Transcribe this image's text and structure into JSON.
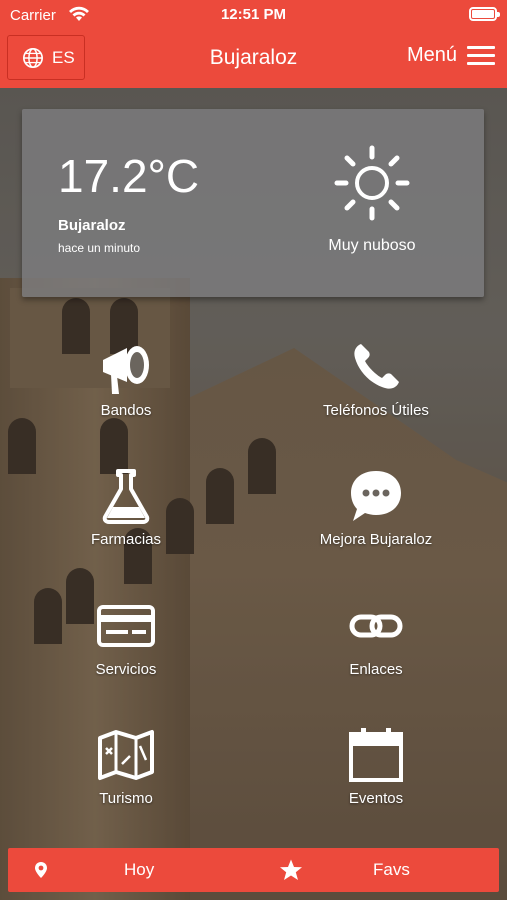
{
  "status_bar": {
    "carrier": "Carrier",
    "time": "12:51 PM"
  },
  "navbar": {
    "lang": "ES",
    "title": "Bujaraloz",
    "menu": "Menú"
  },
  "weather": {
    "temperature": "17.2°C",
    "place": "Bujaraloz",
    "updated": "hace un minuto",
    "condition": "Muy nuboso"
  },
  "grid": {
    "bandos": "Bandos",
    "telefonos": "Teléfonos Útiles",
    "farmacias": "Farmacias",
    "mejora": "Mejora Bujaraloz",
    "servicios": "Servicios",
    "enlaces": "Enlaces",
    "turismo": "Turismo",
    "eventos": "Eventos"
  },
  "tabbar": {
    "hoy": "Hoy",
    "favs": "Favs"
  },
  "colors": {
    "brand": "#ec4a3c"
  },
  "icons": {
    "lang": "globe-icon",
    "menu": "hamburger-icon",
    "weather": "sun-icon",
    "bandos": "megaphone-icon",
    "telefonos": "phone-icon",
    "farmacias": "flask-icon",
    "mejora": "chat-bubble-icon",
    "servicios": "credit-card-icon",
    "enlaces": "link-icon",
    "turismo": "map-icon",
    "eventos": "calendar-icon",
    "hoy": "location-pin-icon",
    "favs": "star-icon"
  }
}
